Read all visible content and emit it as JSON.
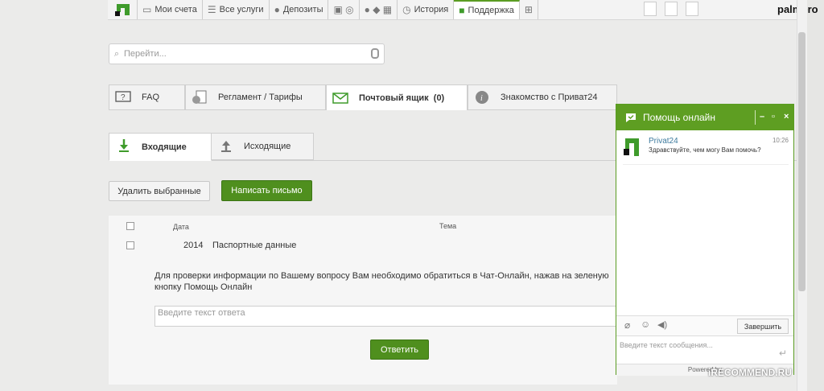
{
  "user": {
    "name": "palmero"
  },
  "topnav": {
    "items": [
      {
        "label": "Мои счета",
        "icon": "card-icon"
      },
      {
        "label": "Все услуги",
        "icon": "list-icon"
      },
      {
        "label": "Депозиты",
        "icon": "piggy-icon"
      },
      {
        "label": "",
        "icon": "transport-icon"
      },
      {
        "label": "",
        "icon": "apps-icon"
      },
      {
        "label": "История",
        "icon": "clock-icon"
      },
      {
        "label": "Поддержка",
        "icon": "support-icon"
      },
      {
        "label": "",
        "icon": "cart-icon"
      }
    ]
  },
  "search": {
    "placeholder": "Перейти..."
  },
  "tabs": [
    {
      "label": "FAQ",
      "icon": "question-icon"
    },
    {
      "label": "Регламент / Тарифы",
      "icon": "coins-icon"
    },
    {
      "label": "Почтовый ящик",
      "count": "(0)",
      "icon": "mail-icon"
    },
    {
      "label": "Знакомство с Приват24",
      "icon": "info-icon"
    }
  ],
  "subtabs": {
    "inbox": "Входящие",
    "outbox": "Исходящие"
  },
  "actions": {
    "delete": "Удалить выбранные",
    "compose": "Написать письмо"
  },
  "list": {
    "col_date": "Дата",
    "col_subject": "Тема",
    "row": {
      "date": "2014",
      "subject": "Паспортные данные"
    },
    "body": "Для проверки информации по Вашему вопросу Вам необходимо обратиться в Чат-Онлайн, нажав на зеленую кнопку Помощь Онлайн",
    "reply_placeholder": "Введите текст ответа",
    "reply_button": "Ответить"
  },
  "chat": {
    "title": "Помощь онлайн",
    "sender": "Privat24",
    "time": "10:26",
    "message": "Здравствуйте, чем могу Вам помочь?",
    "end_button": "Завершить",
    "input_placeholder": "Введите текст сообщения...",
    "footer": "Powered by"
  },
  "watermark": "iRECOMMEND.RU",
  "colors": {
    "accent": "#5e9e22",
    "button": "#4f8f1e"
  }
}
